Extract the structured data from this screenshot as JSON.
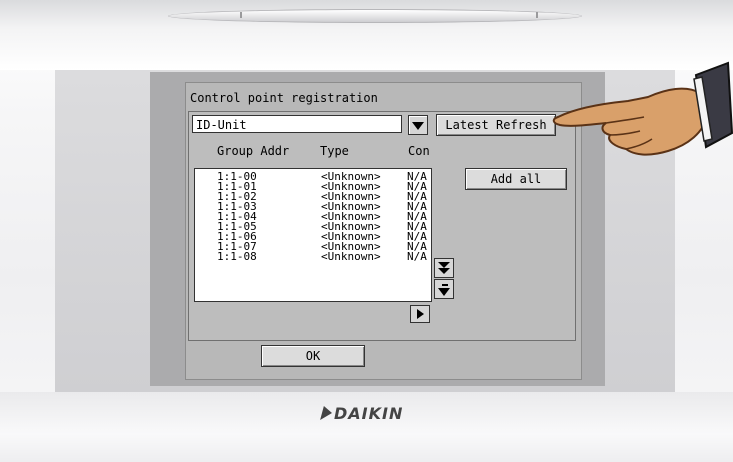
{
  "screen": {
    "title": "Control point registration",
    "selector": {
      "value": "ID-Unit"
    },
    "buttons": {
      "latest_refresh": "Latest Refresh",
      "add_all": "Add all",
      "ok": "OK"
    },
    "columns": [
      "Group Addr",
      "Type",
      "Con"
    ],
    "rows": [
      {
        "addr": "1:1-00",
        "type": "<Unknown>",
        "con": "N/A"
      },
      {
        "addr": "1:1-01",
        "type": "<Unknown>",
        "con": "N/A"
      },
      {
        "addr": "1:1-02",
        "type": "<Unknown>",
        "con": "N/A"
      },
      {
        "addr": "1:1-03",
        "type": "<Unknown>",
        "con": "N/A"
      },
      {
        "addr": "1:1-04",
        "type": "<Unknown>",
        "con": "N/A"
      },
      {
        "addr": "1:1-05",
        "type": "<Unknown>",
        "con": "N/A"
      },
      {
        "addr": "1:1-06",
        "type": "<Unknown>",
        "con": "N/A"
      },
      {
        "addr": "1:1-07",
        "type": "<Unknown>",
        "con": "N/A"
      },
      {
        "addr": "1:1-08",
        "type": "<Unknown>",
        "con": "N/A"
      }
    ]
  },
  "device": {
    "brand": "DAIKIN"
  },
  "icons": {
    "dropdown": "chevron-down-icon",
    "scroll_bottom": "double-chevron-down-icon",
    "scroll_down": "chevron-down-icon",
    "scroll_right": "chevron-right-icon",
    "pointer": "pointing-hand-icon"
  }
}
